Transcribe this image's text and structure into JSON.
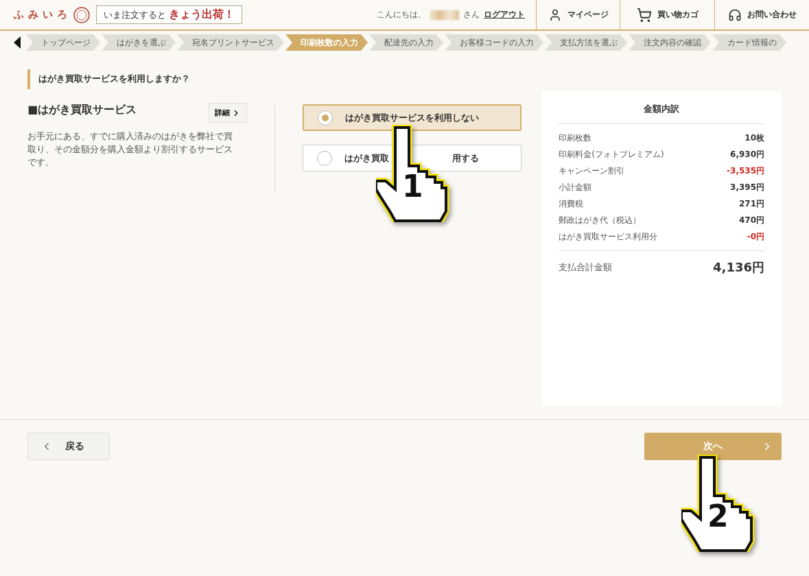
{
  "header": {
    "logo": "ふみいろ",
    "promo_prefix": "いま注文すると",
    "promo_highlight": "きょう出荷！",
    "greeting": "こんにちは、",
    "honorific": "さん",
    "logout": "ログアウト",
    "nav": [
      {
        "kind": "user",
        "label": "マイページ"
      },
      {
        "kind": "cart",
        "label": "買い物カゴ"
      },
      {
        "kind": "support",
        "label": "お問い合わせ"
      }
    ]
  },
  "steps": [
    {
      "label": "トップページ",
      "selected": false
    },
    {
      "label": "はがきを選ぶ",
      "selected": false
    },
    {
      "label": "宛名プリントサービス",
      "selected": false
    },
    {
      "label": "印刷枚数の入力",
      "selected": true
    },
    {
      "label": "配達先の入力",
      "selected": false
    },
    {
      "label": "お客様コードの入力",
      "selected": false
    },
    {
      "label": "支払方法を選ぶ",
      "selected": false
    },
    {
      "label": "注文内容の確認",
      "selected": false
    },
    {
      "label": "カード情報の",
      "selected": false
    }
  ],
  "question": "はがき買取サービスを利用しますか？",
  "service": {
    "title": "■はがき買取サービス",
    "detail_button": "詳細",
    "description": "お手元にある、すでに購入済みのはがきを弊社で買取り、その金額分を購入金額より割引するサービスです。"
  },
  "options": [
    {
      "label_parts": [
        "はがき買取サービスを利用しない"
      ],
      "selected": true
    },
    {
      "label_parts": [
        "はがき買取",
        "用する"
      ],
      "selected": false
    }
  ],
  "summary": {
    "title": "金額内訳",
    "rows": [
      {
        "label": "印刷枚数",
        "value": "10枚",
        "kind": "normal"
      },
      {
        "label": "印刷料金(フォトプレミアム)",
        "value": "6,930円",
        "kind": "normal"
      },
      {
        "label": "キャンペーン割引",
        "value": "-3,535円",
        "kind": "discount"
      },
      {
        "label": "小計金額",
        "value": "3,395円",
        "kind": "normal"
      },
      {
        "label": "消費税",
        "value": "271円",
        "kind": "normal"
      },
      {
        "label": "郵政はがき代（税込）",
        "value": "470円",
        "kind": "normal"
      },
      {
        "label": "はがき買取サービス利用分",
        "value": "-0円",
        "kind": "discount"
      }
    ],
    "total_label": "支払合計金額",
    "total_value": "4,136円"
  },
  "back_button": "戻る",
  "next_button": "次へ",
  "annotations": [
    "1",
    "2"
  ]
}
